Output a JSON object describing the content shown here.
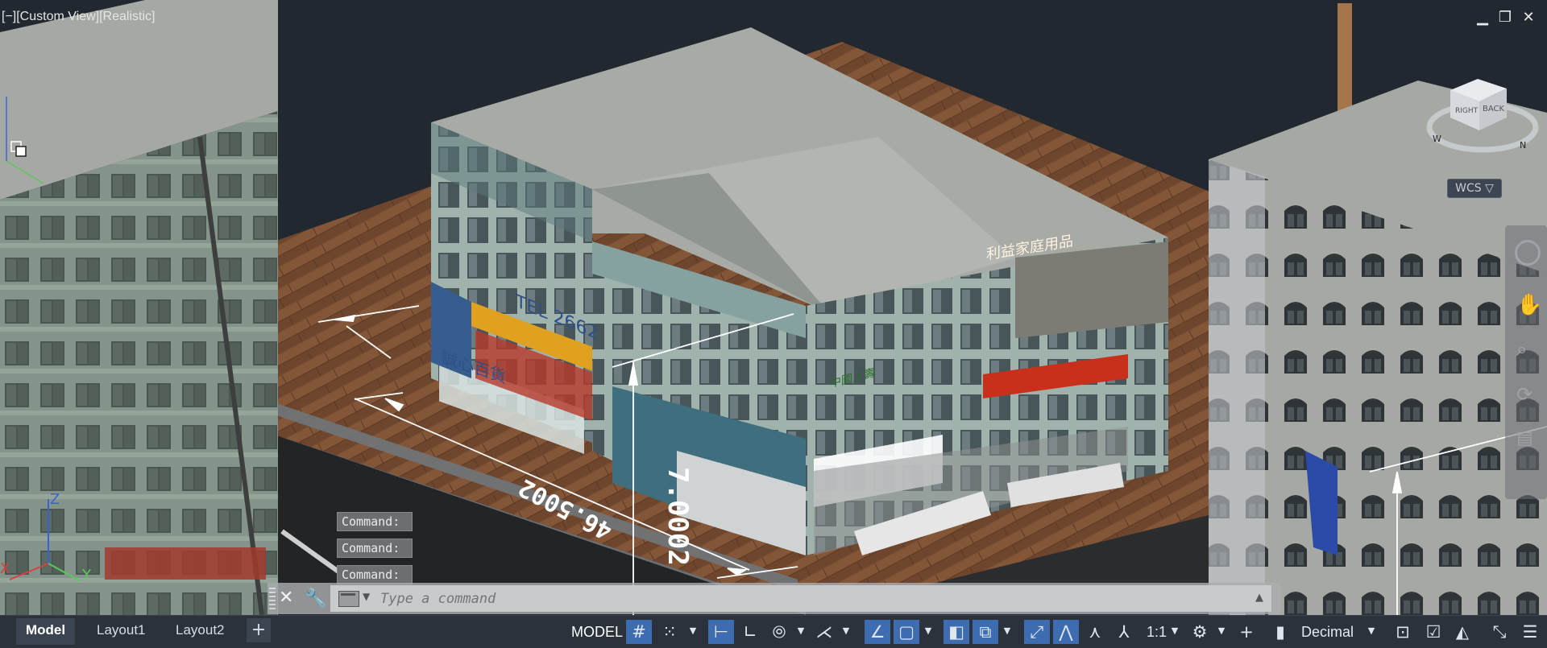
{
  "viewport": {
    "label": "[−][Custom View][Realistic]",
    "window_controls": {
      "minimize": "▁",
      "restore": "❐",
      "close": "✕"
    },
    "wcs_label": "WCS ▽",
    "viewcube": {
      "face_right": "RIGHT",
      "face_back": "BACK",
      "compass_west": "W",
      "compass_north": "N"
    },
    "dimensions": {
      "aligned": "46.5002",
      "vertical": "7.0002"
    },
    "signage": {
      "shop_sign_left": "誠心百貨",
      "shop_phone": "TEL 2662",
      "shop_sign_right": "利益家庭用品",
      "bank_sign": "中國人壽"
    }
  },
  "command": {
    "history": [
      "Command:",
      "Command:",
      "Command:"
    ],
    "placeholder": "Type a command"
  },
  "layout_tabs": [
    "Model",
    "Layout1",
    "Layout2"
  ],
  "status": {
    "model_label": "MODEL",
    "scale": "1:1",
    "units": "Decimal",
    "icons": [
      "grid-icon",
      "snap-icon",
      "ortho-icon",
      "polar-icon",
      "isodraft-icon",
      "object-snap-tracking-icon",
      "object-snap-icon",
      "lineweight-icon",
      "transparency-icon",
      "selection-cycling-icon",
      "3d-osnap-icon",
      "dynamic-ucs-icon",
      "gizmo-icon",
      "annotation-visibility-icon",
      "autoscale-icon",
      "annotation-scale-icon",
      "workspace-gear-icon",
      "annotation-monitor-icon",
      "units-icon",
      "quick-properties-icon",
      "lock-ui-icon",
      "isolate-objects-icon",
      "hardware-acceleration-icon",
      "clean-screen-icon",
      "customization-icon"
    ]
  }
}
